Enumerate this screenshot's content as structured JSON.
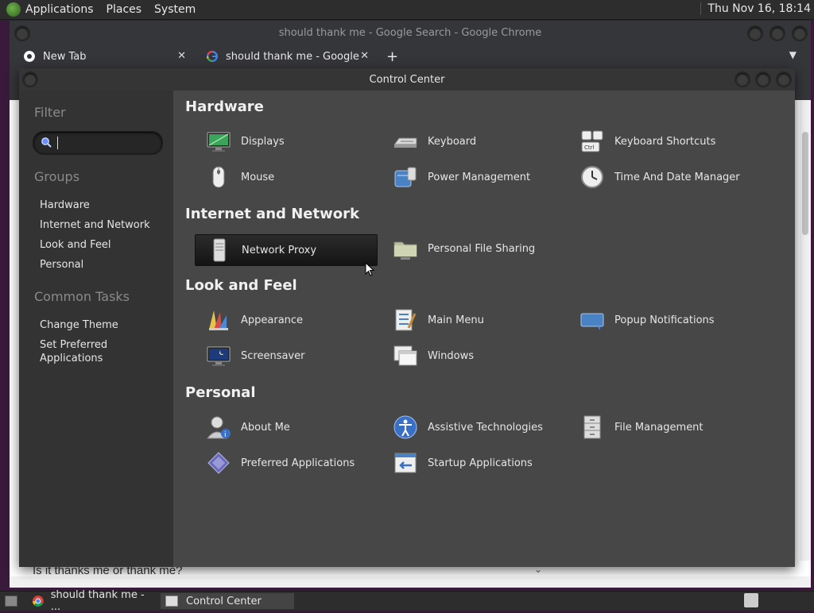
{
  "top_panel": {
    "menus": [
      "Applications",
      "Places",
      "System"
    ],
    "clock": "Thu Nov 16, 18:14"
  },
  "chrome": {
    "window_title": "should thank me - Google Search - Google Chrome",
    "tabs": [
      {
        "title": "New Tab"
      },
      {
        "title": "should thank me - Google Search"
      }
    ],
    "page_text": "Is it thanks me or thank me?"
  },
  "control_center": {
    "title": "Control Center",
    "sidebar": {
      "filter_heading": "Filter",
      "groups_heading": "Groups",
      "groups": [
        "Hardware",
        "Internet and Network",
        "Look and Feel",
        "Personal"
      ],
      "tasks_heading": "Common Tasks",
      "tasks": [
        "Change Theme",
        "Set Preferred Applications"
      ]
    },
    "sections": [
      {
        "title": "Hardware",
        "items": [
          "Displays",
          "Keyboard",
          "Keyboard Shortcuts",
          "Mouse",
          "Power Management",
          "Time And Date Manager"
        ]
      },
      {
        "title": "Internet and Network",
        "items": [
          "Network Proxy",
          "Personal File Sharing"
        ]
      },
      {
        "title": "Look and Feel",
        "items": [
          "Appearance",
          "Main Menu",
          "Popup Notifications",
          "Screensaver",
          "Windows"
        ]
      },
      {
        "title": "Personal",
        "items": [
          "About Me",
          "Assistive Technologies",
          "File Management",
          "Preferred Applications",
          "Startup Applications"
        ]
      }
    ],
    "selected_item": "Network Proxy"
  },
  "taskbar": {
    "items": [
      "should thank me - ...",
      "Control Center"
    ]
  },
  "icons": {
    "top_logo": "mate-logo-icon",
    "chrome_favicon": "chrome-icon",
    "google_favicon": "google-g-icon"
  },
  "colors": {
    "panel": "#2d2d2d",
    "window_bg": "#474747",
    "sidebar_bg": "#333333",
    "selection": "#141414"
  }
}
